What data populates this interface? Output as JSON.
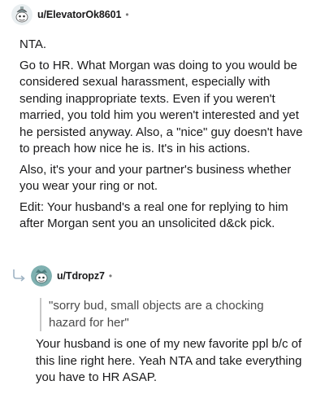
{
  "comment": {
    "username": "u/ElevatorOk8601",
    "separator": "•",
    "avatar": "snoo-avatar-icon",
    "paragraphs": [
      "NTA.",
      "Go to HR. What Morgan was doing to you would be considered sexual harassment, especially with sending inappropriate texts. Even if you weren't married, you told him you weren't interested and yet he persisted anyway. Also, a \"nice\" guy doesn't have to preach how nice he is. It's in his actions.",
      "Also, it's your and your partner's business whether you wear your ring or not.",
      "Edit: Your husband's a real one for replying to him after Morgan sent you an unsolicited d&ck pick."
    ]
  },
  "reply": {
    "username": "u/Tdropz7",
    "separator": "•",
    "avatar": "snoo-avatar-icon",
    "reply_icon": "reply-arrow-icon",
    "quote": "\"sorry bud, small objects are a chocking hazard for her\"",
    "body": "Your husband is one of my new favorite ppl b/c of this line right here. Yeah NTA and take everything you have to HR ASAP."
  },
  "colors": {
    "text": "#1a1a1b",
    "meta": "#7c7c7c",
    "quote_bar": "#c8c8c8",
    "avatar_bg": "#e4ecef",
    "avatar2_bg": "#6fa8a8"
  }
}
